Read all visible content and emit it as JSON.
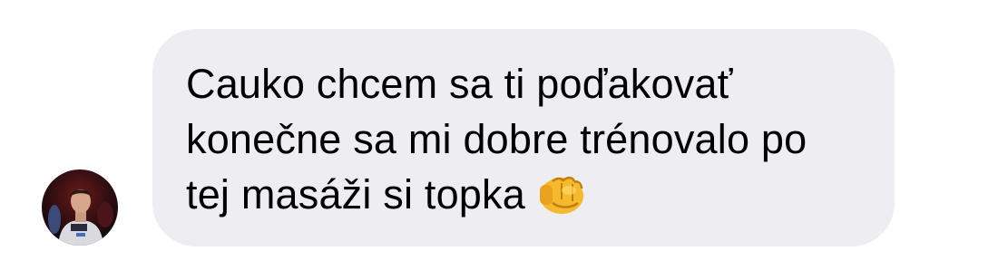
{
  "message": {
    "lines": [
      "Cauko chcem sa ti poďakovať",
      "konečne sa mi dobre trénovalo po",
      "tej masáži si topka"
    ],
    "emoji": "fist-bump-emoji"
  },
  "avatar": {
    "icon": "user-avatar"
  },
  "colors": {
    "bubble": "#eeeef2",
    "text": "#000000",
    "background": "#ffffff",
    "emoji": "#f5b92d"
  }
}
